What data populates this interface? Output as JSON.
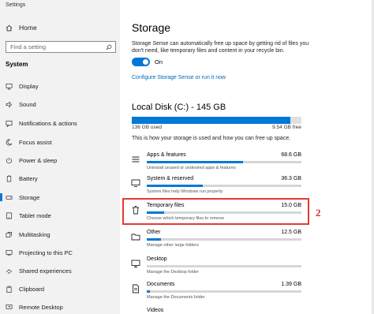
{
  "window": {
    "title": "Settings"
  },
  "sidebar": {
    "home_label": "Home",
    "search_placeholder": "Find a setting",
    "section": "System",
    "items": [
      {
        "label": "Display",
        "icon": "display-icon"
      },
      {
        "label": "Sound",
        "icon": "sound-icon"
      },
      {
        "label": "Notifications & actions",
        "icon": "notifications-icon"
      },
      {
        "label": "Focus assist",
        "icon": "focus-assist-icon"
      },
      {
        "label": "Power & sleep",
        "icon": "power-icon"
      },
      {
        "label": "Battery",
        "icon": "battery-icon"
      },
      {
        "label": "Storage",
        "icon": "storage-icon",
        "selected": true
      },
      {
        "label": "Tablet mode",
        "icon": "tablet-icon"
      },
      {
        "label": "Multitasking",
        "icon": "multitasking-icon"
      },
      {
        "label": "Projecting to this PC",
        "icon": "projecting-icon"
      },
      {
        "label": "Shared experiences",
        "icon": "shared-icon"
      },
      {
        "label": "Clipboard",
        "icon": "clipboard-icon"
      },
      {
        "label": "Remote Desktop",
        "icon": "remote-desktop-icon"
      }
    ]
  },
  "main": {
    "title": "Storage",
    "description": "Storage Sense can automatically free up space by getting rid of files you don't need, like temporary files and content in your recycle bin.",
    "toggle_label": "On",
    "configure_link": "Configure Storage Sense or run it now",
    "disk": {
      "title": "Local Disk (C:) - 145 GB",
      "used_label": "136 GB used",
      "free_label": "9.54 GB free",
      "used_fraction": 0.934
    },
    "info": "This is how your storage is used and how you can free up space.",
    "categories": [
      {
        "name": "Apps & features",
        "size": "68.6 GB",
        "sub": "Uninstall unused or undesired apps & features",
        "fraction": 0.62,
        "icon": "apps-icon"
      },
      {
        "name": "System & reserved",
        "size": "36.3 GB",
        "sub": "System files help Windows run properly",
        "fraction": 0.36,
        "icon": "system-icon"
      },
      {
        "name": "Temporary files",
        "size": "15.0 GB",
        "sub": "Choose which temporary files to remove",
        "fraction": 0.11,
        "icon": "temporary-files-icon"
      },
      {
        "name": "Other",
        "size": "12.5 GB",
        "sub": "Manage other large folders",
        "fraction": 0.09,
        "icon": "other-icon"
      },
      {
        "name": "Desktop",
        "size": "",
        "sub": "Manage the Desktop folder",
        "fraction": 0.0,
        "icon": "desktop-icon"
      },
      {
        "name": "Documents",
        "size": "1.39 GB",
        "sub": "Manage the Documents folder",
        "fraction": 0.02,
        "icon": "documents-icon"
      },
      {
        "name": "Videos",
        "size": "",
        "sub": "",
        "fraction": 0.0,
        "icon": "videos-icon"
      }
    ]
  },
  "annotation": {
    "marker": "2"
  },
  "colors": {
    "accent": "#0078d7",
    "link": "#0067b8",
    "highlight": "#e53935",
    "sidebar_bg": "#f2f2f2"
  }
}
